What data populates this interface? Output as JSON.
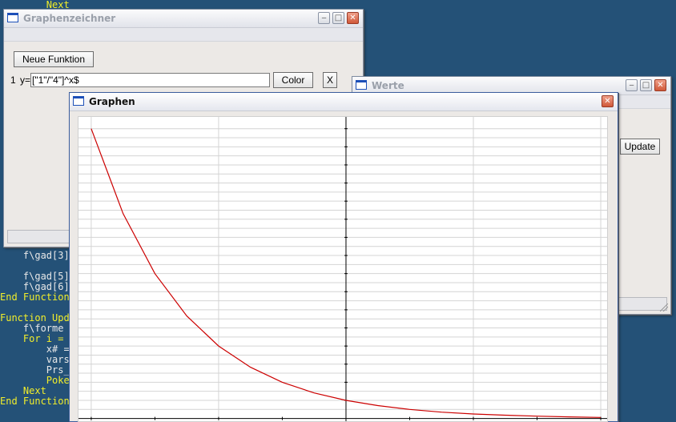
{
  "code_editor": {
    "lines": [
      {
        "text": "        Next",
        "kw": true
      },
      {
        "text": "    f\\gad[3]",
        "kw": false
      },
      {
        "text": "    f\\gad[5]",
        "kw": false
      },
      {
        "text": "    f\\gad[6]",
        "kw": false
      },
      {
        "text": "End Function",
        "kw": true
      },
      {
        "text": "Function Upd",
        "kw": true
      },
      {
        "text": "    f\\forme",
        "kw": false
      },
      {
        "text": "    For i =",
        "kw": true
      },
      {
        "text": "        x# =",
        "kw": false
      },
      {
        "text": "        vars",
        "kw": false
      },
      {
        "text": "        Prs_",
        "kw": false
      },
      {
        "text": "        Poke",
        "kw": true
      },
      {
        "text": "    Next",
        "kw": true
      },
      {
        "text": "End Function",
        "kw": true
      }
    ]
  },
  "window_graphenzeichner": {
    "title": "Graphenzeichner",
    "new_function_label": "Neue Funktion",
    "row_number": "1",
    "y_label": "y=",
    "formula_value": "[\"1\"/\"4\"]^x$",
    "color_button_label": "Color",
    "remove_button_label": "X"
  },
  "window_werte": {
    "title": "Werte",
    "update_button_label": "Update"
  },
  "window_graphen": {
    "title": "Graphen",
    "curve_color": "#cc0000"
  },
  "chart_data": {
    "type": "line",
    "title": "",
    "xlabel": "",
    "ylabel": "",
    "function": "y = (1/4)^x",
    "xlim": [
      -2.1,
      2.05
    ],
    "ylim": [
      -0.15,
      16.65
    ],
    "grid": true,
    "axis_color": "#000000",
    "grid_color": "#d4d4d4",
    "series": [
      {
        "color": "#cc0000",
        "x": [
          -2.0,
          -1.75,
          -1.5,
          -1.25,
          -1.0,
          -0.75,
          -0.5,
          -0.25,
          0.0,
          0.25,
          0.5,
          0.75,
          1.0,
          1.25,
          1.5,
          1.75,
          2.0
        ],
        "y": [
          16.0,
          11.31,
          8.0,
          5.66,
          4.0,
          2.83,
          2.0,
          1.41,
          1.0,
          0.71,
          0.5,
          0.35,
          0.25,
          0.18,
          0.13,
          0.09,
          0.06
        ]
      }
    ]
  }
}
